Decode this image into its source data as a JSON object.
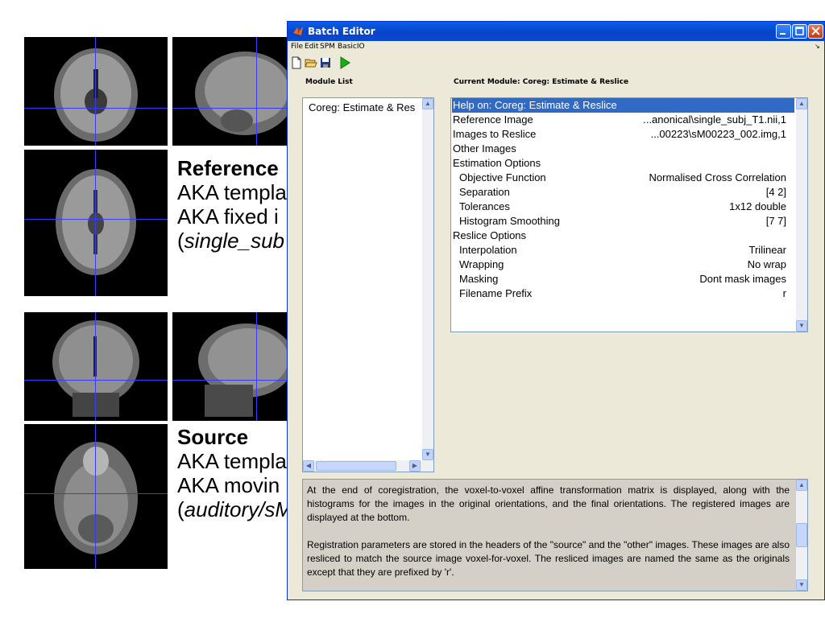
{
  "slide": {
    "reference": {
      "heading": "Reference",
      "line1": "AKA templa",
      "line2": "AKA fixed i",
      "line3_open": "(",
      "line3_italic": "single_sub"
    },
    "source": {
      "heading": "Source",
      "line1": "AKA templa",
      "line2": "AKA movin",
      "line3_open": "(",
      "line3_italic": "auditory/sM"
    }
  },
  "window": {
    "title": "Batch Editor",
    "app_icon": "matlab-icon",
    "menu": [
      "File",
      "Edit",
      "SPM",
      "BasicIO"
    ],
    "toolbar": [
      "new-file-icon",
      "open-folder-icon",
      "save-icon",
      "run-icon"
    ],
    "module_list_label": "Module List",
    "current_module_label": "Current Module: Coreg: Estimate & Reslice",
    "module_list": [
      "Coreg: Estimate & Res"
    ],
    "current_module_rows": [
      {
        "name": "Help on: Coreg: Estimate & Reslice",
        "value": ""
      },
      {
        "name": "Reference Image",
        "value": "...anonical\\single_subj_T1.nii,1"
      },
      {
        "name": "Images to Reslice",
        "value": "...00223\\sM00223_002.img,1"
      },
      {
        "name": "Other Images",
        "value": ""
      },
      {
        "name": "Estimation Options",
        "value": ""
      },
      {
        "name": "Objective Function",
        "value": "Normalised Cross Correlation"
      },
      {
        "name": "Separation",
        "value": "[4 2]"
      },
      {
        "name": "Tolerances",
        "value": "1x12 double"
      },
      {
        "name": "Histogram Smoothing",
        "value": "[7 7]"
      },
      {
        "name": "Reslice Options",
        "value": ""
      },
      {
        "name": "Interpolation",
        "value": "Trilinear"
      },
      {
        "name": "Wrapping",
        "value": "No wrap"
      },
      {
        "name": "Masking",
        "value": "Dont mask images"
      },
      {
        "name": "Filename Prefix",
        "value": "r"
      }
    ],
    "help_paragraph_1": "At the end of coregistration, the voxel-to-voxel affine transformation matrix is displayed, along with the histograms for the images in the original orientations, and the final orientations. The registered images are displayed at the bottom.",
    "help_paragraph_2": "Registration parameters are stored in the headers of the \"source\" and the \"other\" images. These images are also resliced to match the source image voxel-for-voxel. The resliced images are named the same as the originals except that they are prefixed by 'r'."
  }
}
